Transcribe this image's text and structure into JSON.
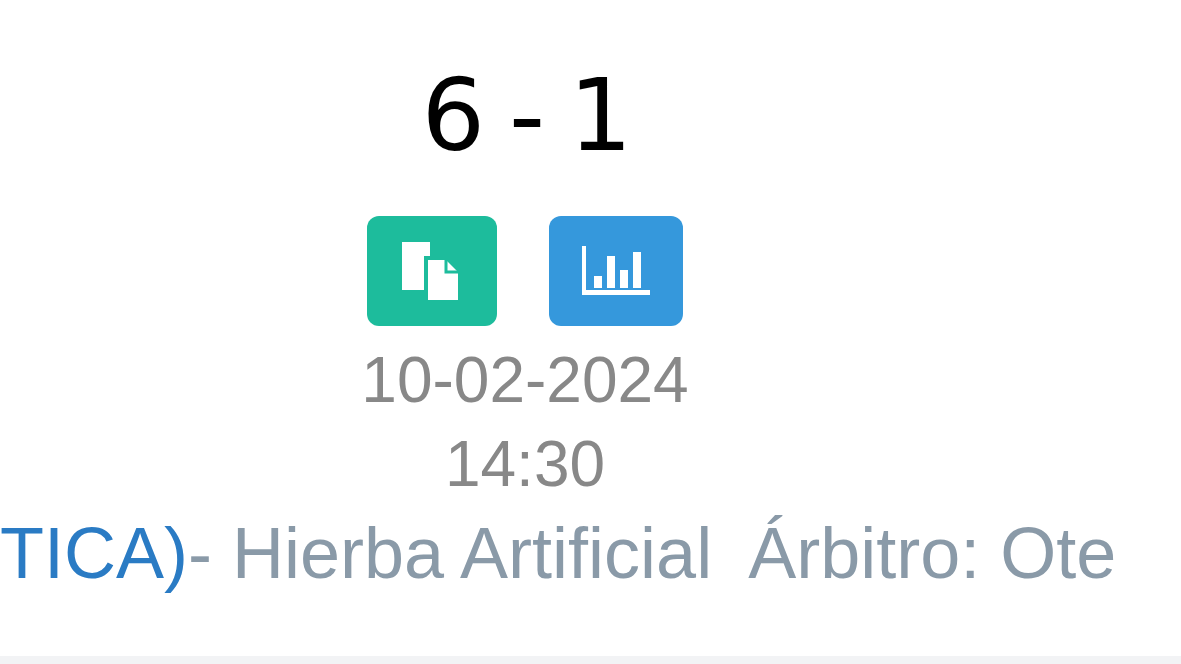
{
  "score": "6 - 1",
  "actions": [
    {
      "kind": "copy"
    },
    {
      "kind": "stats"
    }
  ],
  "date": "10-02-2024",
  "time": "14:30",
  "details": {
    "venue_link": "TICA)",
    "surface": "- Hierba Artificial",
    "referee": "Árbitro: Ote"
  }
}
